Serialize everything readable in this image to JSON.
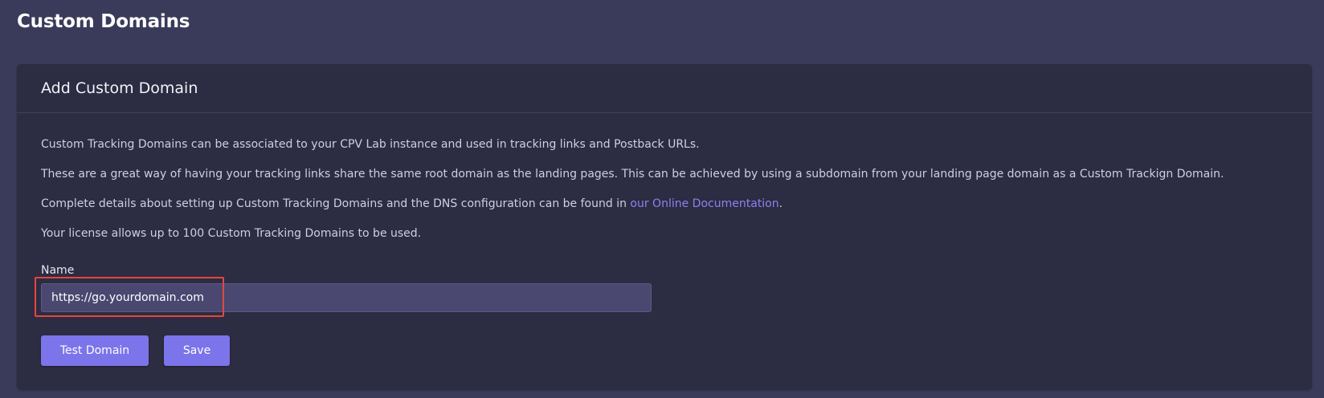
{
  "page": {
    "title": "Custom Domains"
  },
  "card": {
    "title": "Add Custom Domain",
    "paragraphs": {
      "p1": "Custom Tracking Domains can be associated to your CPV Lab instance and used in tracking links and Postback URLs.",
      "p2": "These are a great way of having your tracking links share the same root domain as the landing pages. This can be achieved by using a subdomain from your landing page domain as a Custom Trackign Domain.",
      "p3_prefix": "Complete details about setting up Custom Tracking Domains and the DNS configuration can be found in ",
      "p3_link": "our Online Documentation",
      "p3_suffix": ".",
      "p4": "Your license allows up to 100 Custom Tracking Domains to be used."
    },
    "form": {
      "name_label": "Name",
      "name_value": "https://go.yourdomain.com"
    },
    "buttons": {
      "test": "Test Domain",
      "save": "Save"
    }
  },
  "colors": {
    "page_bg": "#3a3a5a",
    "card_bg": "#2c2c42",
    "accent": "#7b74ea",
    "link": "#8b83f0",
    "highlight": "#e5473f"
  }
}
